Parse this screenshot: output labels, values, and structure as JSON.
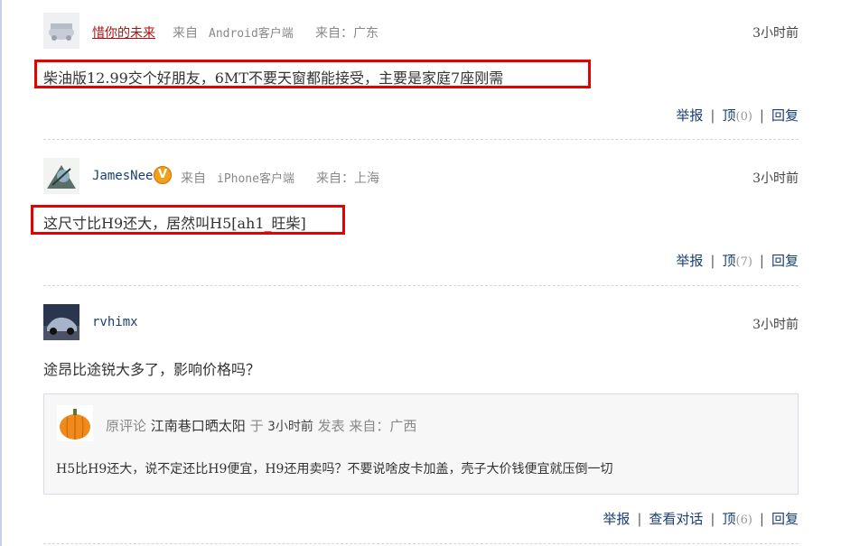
{
  "comments": [
    {
      "username": "惜你的未来",
      "client_prefix": "来自",
      "client": "Android客户端",
      "region": "来自：广东",
      "time": "3小时前",
      "text": "柴油版12.99交个好朋友，6MT不要天窗都能接受，主要是家庭7座刚需",
      "actions": {
        "report": "举报",
        "up": "顶",
        "up_count": "(0)",
        "reply": "回复"
      }
    },
    {
      "username": "JamesNee",
      "verified_badge": "V",
      "client_prefix": "来自",
      "client": "iPhone客户端",
      "region": "来自：上海",
      "time": "3小时前",
      "text": "这尺寸比H9还大，居然叫H5[ah1_旺柴]",
      "actions": {
        "report": "举报",
        "up": "顶",
        "up_count": "(7)",
        "reply": "回复"
      }
    },
    {
      "username": "rvhimx",
      "time": "3小时前",
      "text": "途昂比途锐大多了，影响价格吗？",
      "quote": {
        "label": "原评论",
        "user": "江南巷口晒太阳",
        "at": "于",
        "time": "3小时前",
        "posted": "发表",
        "region": "来自：广西",
        "text": "H5比H9还大，说不定还比H9便宜，H9还用卖吗？不要说啥皮卡加盖，壳子大价钱便宜就压倒一切"
      },
      "actions": {
        "report": "举报",
        "view_dialog": "查看对话",
        "up": "顶",
        "up_count": "(6)",
        "reply": "回复"
      }
    }
  ],
  "colors": {
    "highlight": "#e60000",
    "link": "#1b3f72",
    "username_red": "#aa1111"
  }
}
